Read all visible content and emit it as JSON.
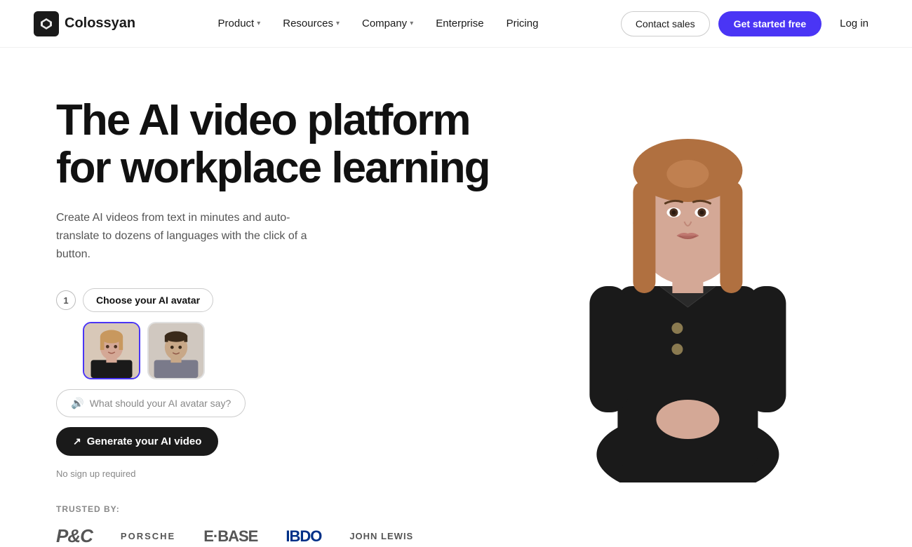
{
  "nav": {
    "logo_text": "Colossyan",
    "links": [
      {
        "label": "Product",
        "has_dropdown": true
      },
      {
        "label": "Resources",
        "has_dropdown": true
      },
      {
        "label": "Company",
        "has_dropdown": true
      },
      {
        "label": "Enterprise",
        "has_dropdown": false
      },
      {
        "label": "Pricing",
        "has_dropdown": false
      }
    ],
    "contact_sales": "Contact sales",
    "get_started": "Get started free",
    "login": "Log in"
  },
  "hero": {
    "title_line1": "The AI video platform",
    "title_line2": "for workplace learning",
    "subtitle": "Create AI videos from text in minutes and auto-translate to dozens of languages with the click of a button.",
    "step1_num": "1",
    "step1_label": "Choose your AI avatar",
    "step2_placeholder": "What should your AI avatar say?",
    "step3_label": "Generate your AI video",
    "no_signup": "No sign up required"
  },
  "trusted": {
    "label": "TRUSTED BY:",
    "logos": [
      {
        "text": "P&C",
        "style": "pg"
      },
      {
        "text": "PORSCHE",
        "style": "porsche"
      },
      {
        "text": "E·BASE",
        "style": "ebase"
      },
      {
        "text": "IBDO",
        "style": "ibdo"
      },
      {
        "text": "JOHN LEWIS",
        "style": "jl"
      }
    ]
  }
}
